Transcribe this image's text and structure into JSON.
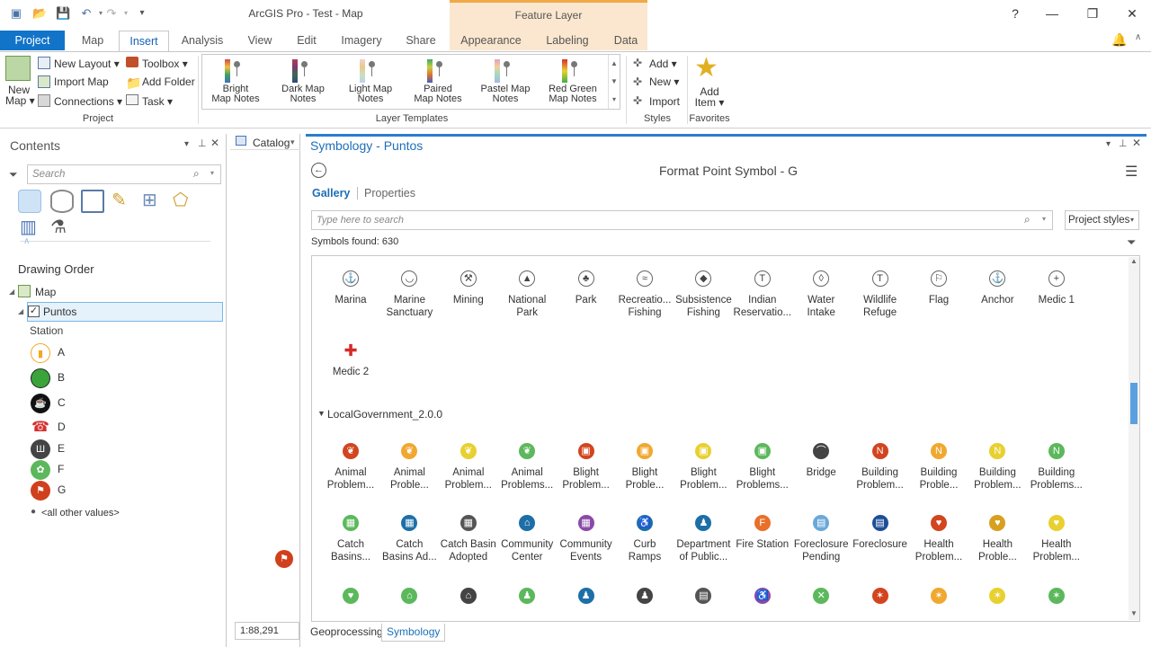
{
  "window": {
    "title": "ArcGIS Pro - Test - Map",
    "context_tab": "Feature Layer",
    "help": "?",
    "minimize": "—",
    "restore": "❐",
    "close": "✕"
  },
  "tabs": [
    "Project",
    "Map",
    "Insert",
    "Analysis",
    "View",
    "Edit",
    "Imagery",
    "Share",
    "Appearance",
    "Labeling",
    "Data"
  ],
  "ribbon": {
    "new_map": [
      "New",
      "Map ▾"
    ],
    "new_layout": "New Layout ▾",
    "import_map": "Import Map",
    "connections": "Connections ▾",
    "toolbox": "Toolbox ▾",
    "add_folder": "Add Folder",
    "task": "Task ▾",
    "group_project": "Project",
    "templates": [
      {
        "l1": "Bright",
        "l2": "Map Notes",
        "color": "#d04a4a"
      },
      {
        "l1": "Dark Map",
        "l2": "Notes",
        "color": "#7a3a70"
      },
      {
        "l1": "Light Map",
        "l2": "Notes",
        "color": "#e8c98a"
      },
      {
        "l1": "Paired",
        "l2": "Map Notes",
        "color": "#3fa86a"
      },
      {
        "l1": "Pastel Map",
        "l2": "Notes",
        "color": "#e6a0b8"
      },
      {
        "l1": "Red Green",
        "l2": "Map Notes",
        "color": "#d83030"
      }
    ],
    "group_templates": "Layer Templates",
    "add": "Add ▾",
    "new": "New ▾",
    "import": "Import",
    "group_styles": "Styles",
    "add_item": [
      "Add",
      "Item ▾"
    ],
    "group_favorites": "Favorites"
  },
  "contents": {
    "title": "Contents",
    "search_placeholder": "Search",
    "drawing_order": "Drawing Order",
    "map": "Map",
    "layer": "Puntos",
    "field": "Station",
    "legend": [
      {
        "label": "A",
        "color": "#f5a623",
        "glyph": "▮"
      },
      {
        "label": "B",
        "color": "#3aa43a",
        "glyph": ""
      },
      {
        "label": "C",
        "color": "#111111",
        "glyph": "☕"
      },
      {
        "label": "D",
        "color": "#d43030",
        "glyph": "☎"
      },
      {
        "label": "E",
        "color": "#444444",
        "glyph": "Ш"
      },
      {
        "label": "F",
        "color": "#5cb85c",
        "glyph": "✿"
      },
      {
        "label": "G",
        "color": "#d0401c",
        "glyph": "⚑"
      }
    ],
    "other": "<all other values>"
  },
  "catalog": {
    "title": "Catalog",
    "scale": "1:88,291"
  },
  "symbology": {
    "title": "Symbology - Puntos",
    "heading": "Format Point Symbol - G",
    "tab_gallery": "Gallery",
    "tab_properties": "Properties",
    "search_placeholder": "Type here to search",
    "style": "Project styles",
    "found": "Symbols found: 630",
    "group_name": "LocalGovernment_2.0.0",
    "row1": [
      {
        "n": "Marina",
        "color": "#ffffff",
        "g": "⚓"
      },
      {
        "n": "Marine|Sanctuary",
        "color": "#ffffff",
        "g": "◡"
      },
      {
        "n": "Mining",
        "color": "#ffffff",
        "g": "⚒"
      },
      {
        "n": "National|Park",
        "color": "#ffffff",
        "g": "▲"
      },
      {
        "n": "Park",
        "color": "#ffffff",
        "g": "♣"
      },
      {
        "n": "Recreatio...|Fishing",
        "color": "#ffffff",
        "g": "≈"
      },
      {
        "n": "Subsistence|Fishing",
        "color": "#ffffff",
        "g": "◆"
      },
      {
        "n": "Indian|Reservatio...",
        "color": "#ffffff",
        "g": "T"
      },
      {
        "n": "Water|Intake",
        "color": "#ffffff",
        "g": "◊"
      },
      {
        "n": "Wildlife|Refuge",
        "color": "#ffffff",
        "g": "T"
      },
      {
        "n": "Flag",
        "color": "#ffffff",
        "g": "⚐"
      },
      {
        "n": "Anchor",
        "color": "#ffffff",
        "g": "⚓"
      },
      {
        "n": "Medic 1",
        "color": "#ffffff",
        "g": "+"
      }
    ],
    "row2": [
      {
        "n": "Medic 2",
        "color": "#ffffff",
        "g": "✚"
      }
    ],
    "row3": [
      {
        "n": "Animal|Problem...",
        "color": "#d2451e",
        "g": "❦"
      },
      {
        "n": "Animal|Proble...",
        "color": "#f0a830",
        "g": "❦"
      },
      {
        "n": "Animal|Problem...",
        "color": "#e8d030",
        "g": "❦"
      },
      {
        "n": "Animal|Problems...",
        "color": "#5cb85c",
        "g": "❦"
      },
      {
        "n": "Blight|Problem...",
        "color": "#d2451e",
        "g": "▣"
      },
      {
        "n": "Blight|Proble...",
        "color": "#f0a830",
        "g": "▣"
      },
      {
        "n": "Blight|Problem...",
        "color": "#e8d030",
        "g": "▣"
      },
      {
        "n": "Blight|Problems...",
        "color": "#5cb85c",
        "g": "▣"
      },
      {
        "n": "Bridge",
        "color": "#444444",
        "g": "⌒"
      },
      {
        "n": "Building|Problem...",
        "color": "#d2451e",
        "g": "N"
      },
      {
        "n": "Building|Proble...",
        "color": "#f0a830",
        "g": "N"
      },
      {
        "n": "Building|Problem...",
        "color": "#e8d030",
        "g": "N"
      },
      {
        "n": "Building|Problems...",
        "color": "#5cb85c",
        "g": "N"
      }
    ],
    "row4": [
      {
        "n": "Catch|Basins...",
        "color": "#5cb85c",
        "g": "▦"
      },
      {
        "n": "Catch|Basins Ad...",
        "color": "#1d6fa8",
        "g": "▦"
      },
      {
        "n": "Catch Basin|Adopted",
        "color": "#555555",
        "g": "▦"
      },
      {
        "n": "Community|Center",
        "color": "#1d6fa8",
        "g": "⌂"
      },
      {
        "n": "Community|Events",
        "color": "#8a4aa8",
        "g": "▦"
      },
      {
        "n": "Curb|Ramps",
        "color": "#1d6fa8",
        "g": "♿"
      },
      {
        "n": "Department|of Public...",
        "color": "#1d6fa8",
        "g": "♟"
      },
      {
        "n": "Fire Station",
        "color": "#e8702a",
        "g": "F"
      },
      {
        "n": "Foreclosure|Pending",
        "color": "#6aa8d8",
        "g": "▤"
      },
      {
        "n": "Foreclosure",
        "color": "#1d4f98",
        "g": "▤"
      },
      {
        "n": "Health|Problem...",
        "color": "#d2451e",
        "g": "♥"
      },
      {
        "n": "Health|Proble...",
        "color": "#d8a020",
        "g": "♥"
      },
      {
        "n": "Health|Problem...",
        "color": "#e8d030",
        "g": "♥"
      }
    ],
    "row5": [
      {
        "color": "#5cb85c",
        "g": "♥"
      },
      {
        "color": "#5cb85c",
        "g": "⌂"
      },
      {
        "color": "#444444",
        "g": "⌂"
      },
      {
        "color": "#5cb85c",
        "g": "♟"
      },
      {
        "color": "#1d6fa8",
        "g": "♟"
      },
      {
        "color": "#444444",
        "g": "♟"
      },
      {
        "color": "#555555",
        "g": "▤"
      },
      {
        "color": "#8a4aa8",
        "g": "♿"
      },
      {
        "color": "#5cb85c",
        "g": "✕"
      },
      {
        "color": "#d2451e",
        "g": "✶"
      },
      {
        "color": "#f0a830",
        "g": "✶"
      },
      {
        "color": "#e8d030",
        "g": "✶"
      },
      {
        "color": "#5cb85c",
        "g": "✶"
      }
    ]
  },
  "bottom_tabs": [
    "Geoprocessing",
    "Symbology"
  ]
}
